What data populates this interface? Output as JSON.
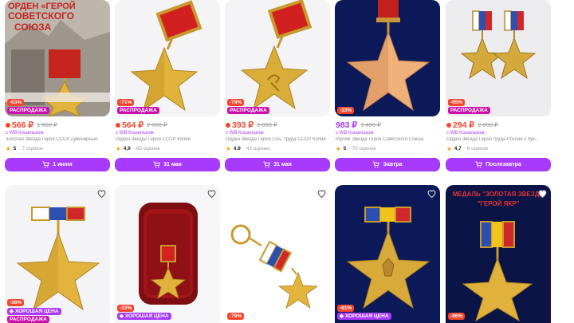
{
  "row1": [
    {
      "image_text": [
        "ОРДЕН «ГЕРОЙ",
        "СОВЕТСКОГО",
        "СОЮЗА"
      ],
      "discount": "-63%",
      "badge": "РАСПРОДАЖА",
      "price": "566 ₽",
      "old_price": "1 600 ₽",
      "seller": "с WB Кошельком",
      "title": "Золотая Звезда Героя СССР сувенирный",
      "rating": "5",
      "reviews": "· 7 оценок",
      "button": "1 июня",
      "price_style": "red"
    },
    {
      "discount": "-71%",
      "badge": "РАСПРОДАЖА",
      "price": "564 ₽",
      "old_price": "2 000 ₽",
      "seller": "с WB Кошельком",
      "title": "Орден Звезда Героя СССР Копия",
      "rating": "4,9",
      "reviews": "· 65 оценок",
      "button": "31 мая",
      "price_style": "red"
    },
    {
      "discount": "-79%",
      "badge": "РАСПРОДАЖА",
      "price": "393 ₽",
      "old_price": "2 000 ₽",
      "seller": "с WB Кошельком",
      "title": "Орден Звезда Героя Соц. труда СССР Копия",
      "rating": "4,9",
      "reviews": "· 42 оценки",
      "button": "31 мая",
      "price_style": "red"
    },
    {
      "discount": "-33%",
      "badge": "",
      "price": "983 ₽",
      "old_price": "1 400 ₽",
      "seller": "с WB Кошельком",
      "title": "Муляж Звезда Героя Советского Союза",
      "rating": "5",
      "reviews": "· 70 оценок",
      "button": "Завтра",
      "price_style": "violet"
    },
    {
      "discount": "-85%",
      "badge": "РАСПРОДАЖА",
      "price": "294 ₽",
      "old_price": "2 000 ₽",
      "seller": "с WB Кошельком",
      "title": "Орден Звезда Героя труда России с бук...",
      "rating": "4,7",
      "reviews": "· 6 оценок",
      "button": "Послезавтра",
      "price_style": "red"
    }
  ],
  "row2": [
    {
      "discount": "-38%",
      "badge": "ХОРОШАЯ ЦЕНА",
      "badge2": "РАСПРОДАЖА"
    },
    {
      "discount": "-33%",
      "badge": "ХОРОШАЯ ЦЕНА"
    },
    {
      "discount": "-79%"
    },
    {
      "discount": "-61%",
      "badge": "ХОРОШАЯ ЦЕНА"
    },
    {
      "image_text": [
        "МЕДАЛЬ \"ЗОЛОТАЯ ЗВЕЗДА",
        "\"ГЕРОЙ ЯКР\""
      ],
      "discount": "-86%"
    }
  ],
  "colors": {
    "accent": "#a73afd",
    "price_red": "#f5452e",
    "sale": "#cb11ab",
    "star": "#ff9c00"
  },
  "icons": [
    "heart-icon",
    "cart-icon",
    "star-icon"
  ]
}
